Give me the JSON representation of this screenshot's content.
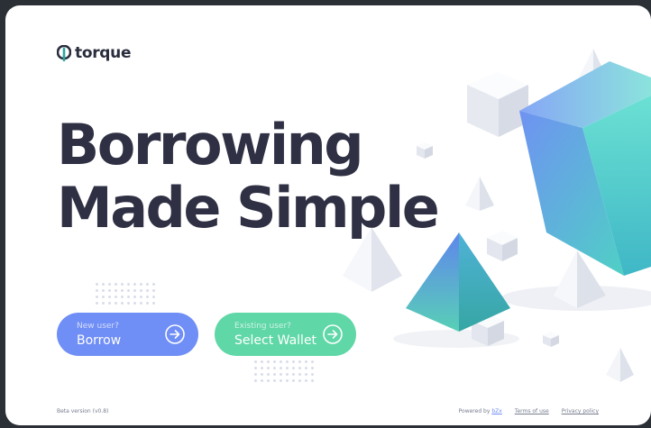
{
  "brand": {
    "name": "torque"
  },
  "hero": {
    "line1": "Borrowing",
    "line2": "Made Simple"
  },
  "buttons": {
    "borrow": {
      "sublabel": "New user?",
      "label": "Borrow"
    },
    "wallet": {
      "sublabel": "Existing user?",
      "label": "Select Wallet"
    }
  },
  "footer": {
    "version": "Beta version (v0.8)",
    "powered_by": "Powered by",
    "powered_link": "bZx",
    "terms": "Terms of use",
    "privacy": "Privacy policy"
  },
  "colors": {
    "background": "#2b3036",
    "text_dark": "#2f3044",
    "borrow_button": "#6f8ef6",
    "wallet_button": "#5fd7a7"
  },
  "icons": [
    "torque-logo-icon",
    "arrow-right-circle-icon"
  ]
}
